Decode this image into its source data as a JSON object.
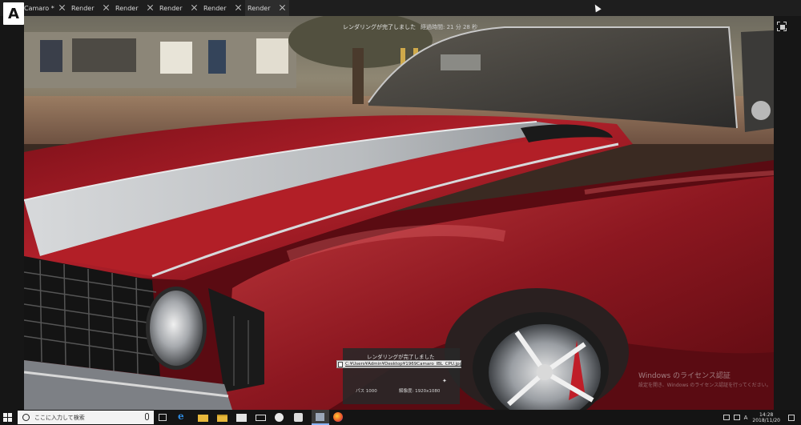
{
  "app": {
    "logo_letter": "A"
  },
  "tabs": [
    {
      "label": "Camaro *",
      "active": false
    },
    {
      "label": "Render",
      "active": false
    },
    {
      "label": "Render",
      "active": false
    },
    {
      "label": "Render",
      "active": false
    },
    {
      "label": "Render",
      "active": false
    },
    {
      "label": "Render",
      "active": true
    }
  ],
  "render": {
    "status": "レンダリングが完了しました",
    "elapsed": "経過時間: 21 分 28 秒"
  },
  "toast": {
    "title": "レンダリングが完了しました",
    "path": "C:¥Users¥Admin¥Desktop¥1969Camaro_IBL_CPU.jpg",
    "passes": "パス 1000",
    "resolution": "解像度: 1920x1080"
  },
  "watermark": {
    "title": "Windows のライセンス認証",
    "subtitle": "設定を開き、Windows のライセンス認証を行ってください。"
  },
  "taskbar": {
    "search_placeholder": "ここに入力して検索",
    "ime": "A",
    "time": "14:28",
    "date": "2018/11/20"
  },
  "colors": {
    "car_red": "#a8161f",
    "stripe": "#c9ccd0",
    "taskbar": "#141414"
  }
}
